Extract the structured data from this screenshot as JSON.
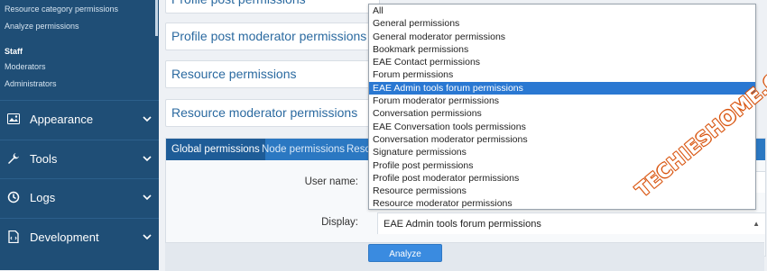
{
  "sidebar": {
    "sub_items_top": [
      "Resource category permissions",
      "Analyze permissions"
    ],
    "staff_heading": "Staff",
    "staff_items": [
      "Moderators",
      "Administrators"
    ],
    "main_items": [
      {
        "label": "Appearance",
        "icon": "appearance-icon"
      },
      {
        "label": "Tools",
        "icon": "wrench-icon"
      },
      {
        "label": "Logs",
        "icon": "logs-icon"
      },
      {
        "label": "Development",
        "icon": "development-icon"
      }
    ]
  },
  "permission_boxes": [
    "Profile post permissions",
    "Profile post moderator permissions",
    "Resource permissions",
    "Resource moderator permissions"
  ],
  "tabs": [
    "Global permissions",
    "Node permissions",
    "Resou"
  ],
  "form": {
    "user_name_label": "User name:",
    "display_label": "Display:",
    "display_value": "EAE Admin tools forum permissions"
  },
  "analyze_button": "Analyze",
  "dropdown": {
    "selected_index": 6,
    "options": [
      "All",
      "General permissions",
      "General moderator permissions",
      "Bookmark permissions",
      "EAE Contact permissions",
      "Forum permissions",
      "EAE Admin tools forum permissions",
      "Forum moderator permissions",
      "Conversation permissions",
      "EAE Conversation tools permissions",
      "Conversation moderator permissions",
      "Signature permissions",
      "Profile post permissions",
      "Profile post moderator permissions",
      "Resource permissions",
      "Resource moderator permissions"
    ]
  },
  "watermark": "TECHIESHOME.COM",
  "colors": {
    "sidebar_bg": "#1f4e76",
    "tab_bar": "#2b78c2",
    "accent_blue": "#2a78d2",
    "link_text": "#2b6aa0",
    "button": "#3a8be0"
  }
}
